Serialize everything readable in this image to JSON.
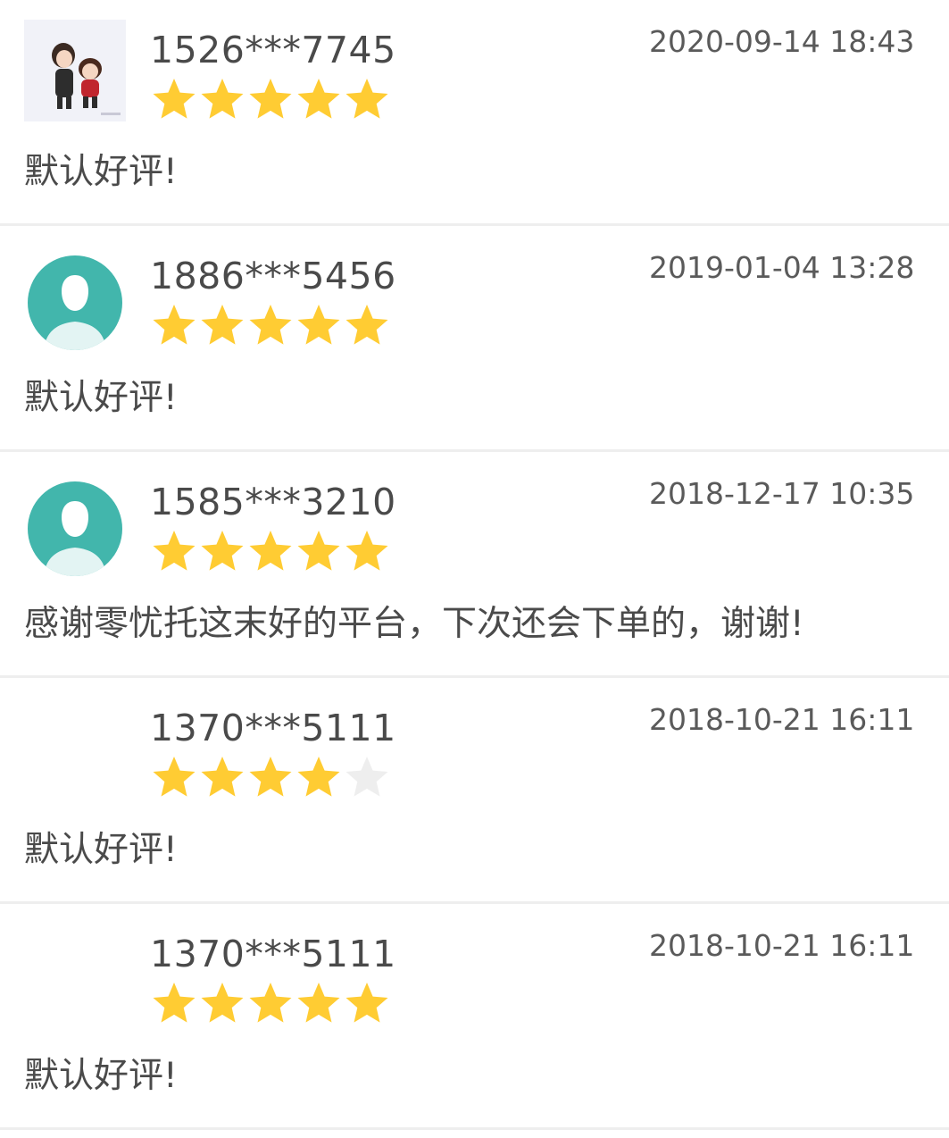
{
  "colors": {
    "star_filled": "#ffcc33",
    "star_empty": "#eeeeee",
    "avatar_default_bg": "#42b6ac",
    "divider": "#eeeeee",
    "text_primary": "#4a4a4a"
  },
  "reviews": [
    {
      "avatar": "photo-avatar",
      "username": "1526***7745",
      "rating": 5,
      "date": "2020-09-14 18:43",
      "comment": "默认好评!"
    },
    {
      "avatar": "default-user-icon",
      "username": "1886***5456",
      "rating": 5,
      "date": "2019-01-04 13:28",
      "comment": "默认好评!"
    },
    {
      "avatar": "default-user-icon",
      "username": "1585***3210",
      "rating": 5,
      "date": "2018-12-17 10:35",
      "comment": "感谢零忧托这末好的平台，下次还会下单的，谢谢!"
    },
    {
      "avatar": "none",
      "username": "1370***5111",
      "rating": 4,
      "date": "2018-10-21 16:11",
      "comment": "默认好评!"
    },
    {
      "avatar": "none",
      "username": "1370***5111",
      "rating": 5,
      "date": "2018-10-21 16:11",
      "comment": "默认好评!"
    }
  ]
}
